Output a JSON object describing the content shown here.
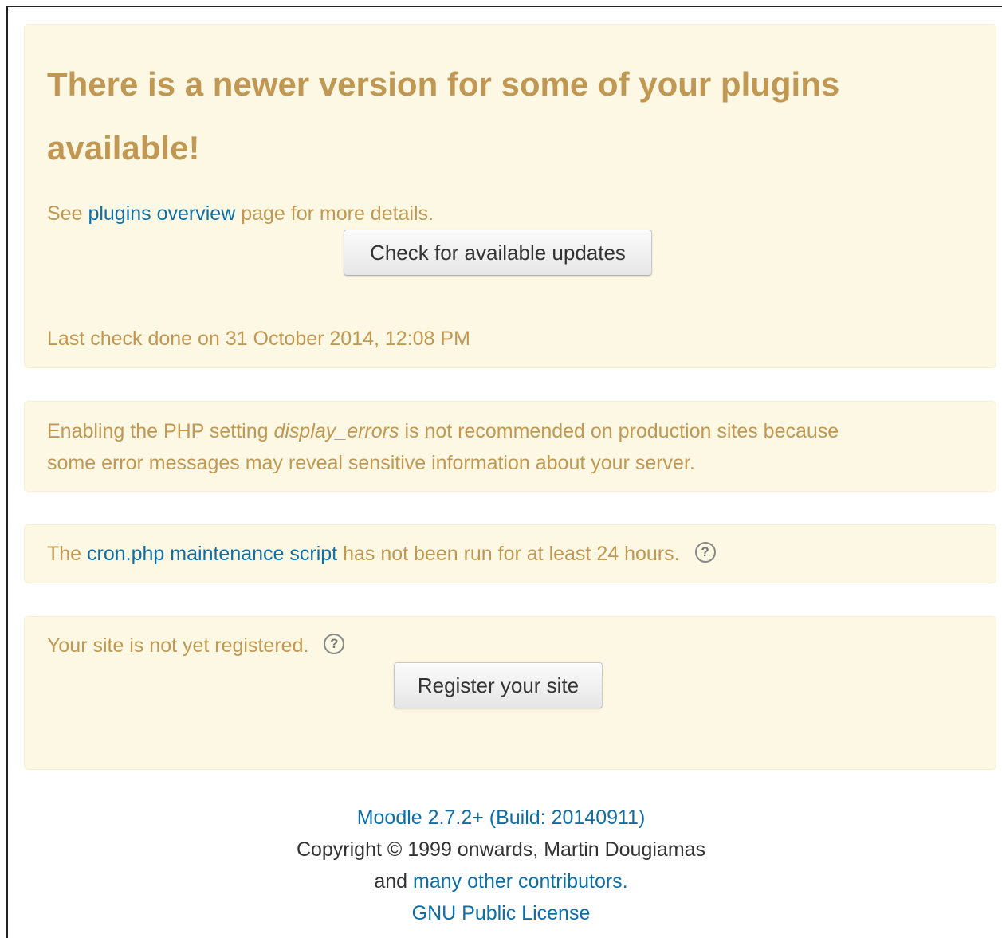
{
  "plugins_notice": {
    "heading": "There is a newer version for some of your plugins available!",
    "see_prefix": "See",
    "overview_link": "plugins overview",
    "see_suffix": "page for more details.",
    "check_button": "Check for available updates",
    "last_check": "Last check done on 31 October 2014, 12:08 PM"
  },
  "display_errors_notice": {
    "prefix": "Enabling the PHP setting",
    "setting": "display_errors",
    "suffix": "is not recommended on production sites because",
    "line2": "some error messages may reveal sensitive information about your server."
  },
  "cron_notice": {
    "prefix": "The",
    "link": "cron.php maintenance script",
    "suffix": "has not been run for at least 24 hours.",
    "help_icon": "question-circle-icon"
  },
  "registration_notice": {
    "text": "Your site is not yet registered.",
    "help_icon": "question-circle-icon",
    "register_button": "Register your site"
  },
  "footer": {
    "version_link": "Moodle 2.7.2+ (Build: 20140911)",
    "copyright": "Copyright © 1999 onwards, Martin Dougiamas",
    "and": "and",
    "contributors_link": "many other contributors.",
    "license_link": "GNU Public License"
  },
  "colors": {
    "notice_background": "#fcf8e3",
    "notice_text": "#c09853",
    "link": "#0f6fa5"
  }
}
